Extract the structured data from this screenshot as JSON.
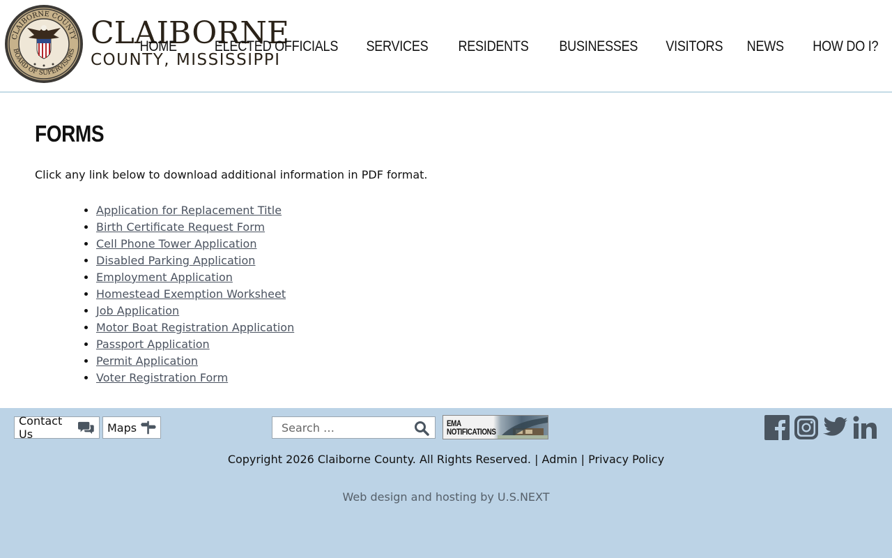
{
  "site": {
    "brand_line1": "CLAIBORNE",
    "brand_line2": "COUNTY, MISSISSIPPI",
    "seal_text_top": "CLAIBORNE COUNTY",
    "seal_text_bottom": "BOARD OF SUPERVISORS"
  },
  "nav": {
    "items": [
      {
        "label": "HOME"
      },
      {
        "label": "ELECTED OFFICIALS"
      },
      {
        "label": "SERVICES"
      },
      {
        "label": "RESIDENTS"
      },
      {
        "label": "BUSINESSES"
      },
      {
        "label": "VISITORS"
      },
      {
        "label": "NEWS"
      },
      {
        "label": "HOW DO I?"
      }
    ]
  },
  "main": {
    "title": "FORMS",
    "intro": "Click any link below to download additional information in PDF format.",
    "forms": [
      {
        "label": "Application for Replacement Title"
      },
      {
        "label": "Birth Certificate Request Form"
      },
      {
        "label": "Cell Phone Tower Application"
      },
      {
        "label": "Disabled Parking Application"
      },
      {
        "label": "Employment Application"
      },
      {
        "label": "Homestead Exemption Worksheet"
      },
      {
        "label": "Job Application"
      },
      {
        "label": "Motor Boat Registration Application"
      },
      {
        "label": "Passport Application"
      },
      {
        "label": "Permit Application"
      },
      {
        "label": "Voter Registration Form"
      }
    ]
  },
  "footer": {
    "contact_label": "Contact Us",
    "maps_label": "Maps",
    "search_placeholder": "Search …",
    "ema_line1": "EMA",
    "ema_line2": "NOTIFICATIONS",
    "copyright": "Copyright 2026 Claiborne County. All Rights Reserved.",
    "sep": "|",
    "admin_label": "Admin",
    "privacy_label": "Privacy Policy",
    "credit": "Web design and hosting by U.S.NEXT",
    "social": [
      "facebook-icon",
      "instagram-icon",
      "twitter-icon",
      "linkedin-icon"
    ]
  },
  "colors": {
    "footer_bg": "#bcd3e6",
    "link": "#4b5360",
    "header_rule": "#c4dbe6",
    "social_icon": "#4a5560"
  }
}
